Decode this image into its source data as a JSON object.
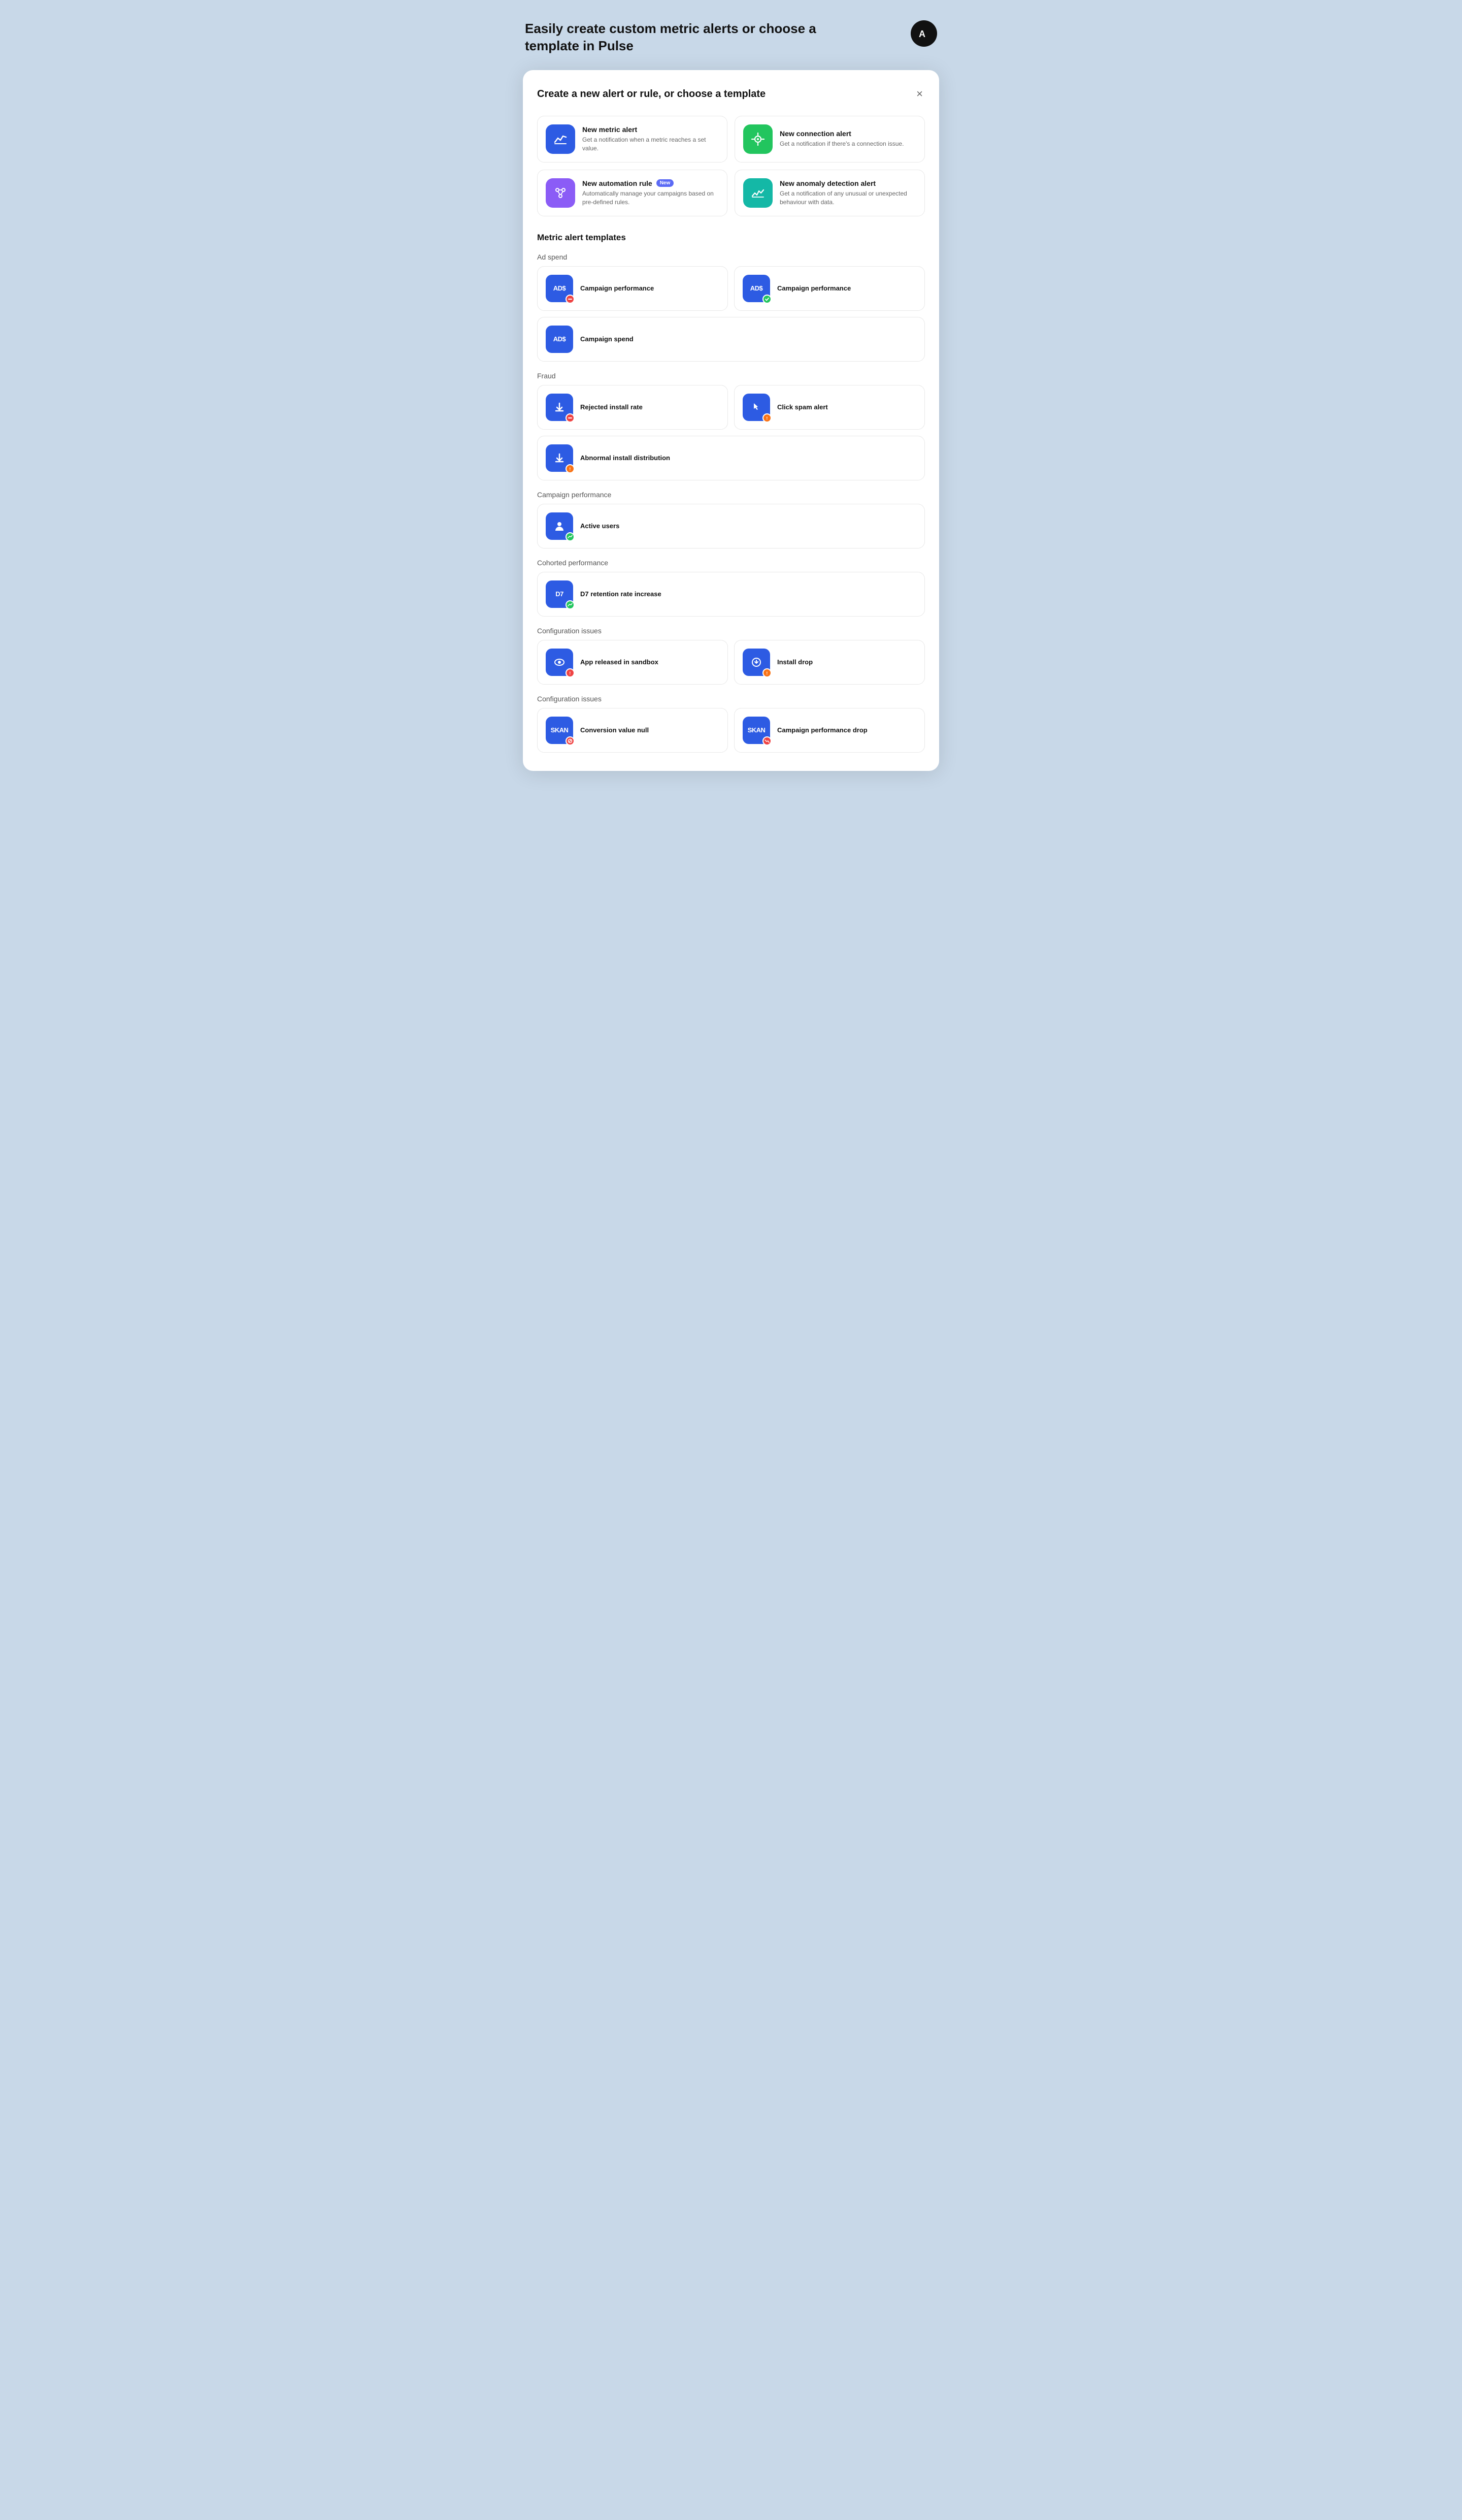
{
  "page": {
    "title": "Easily create custom metric alerts or choose a template in Pulse",
    "logo_alt": "Appsflyer logo"
  },
  "modal": {
    "title": "Create a new alert or rule, or choose a template",
    "close_label": "×"
  },
  "top_options": [
    {
      "id": "metric-alert",
      "title": "New metric alert",
      "desc": "Get a notification when a metric reaches a set value.",
      "icon_color": "#2d5be3",
      "icon_type": "chart"
    },
    {
      "id": "connection-alert",
      "title": "New connection alert",
      "desc": "Get a notification if there's a connection issue.",
      "icon_color": "#22c55e",
      "icon_type": "key"
    },
    {
      "id": "automation-rule",
      "title": "New automation rule",
      "desc": "Automatically manage your campaigns based on pre-defined rules.",
      "icon_color": "#8b5cf6",
      "icon_type": "nodes",
      "badge": "New"
    },
    {
      "id": "anomaly-alert",
      "title": "New anomaly detection alert",
      "desc": "Get a notification of any unusual or unexpected behaviour with data.",
      "icon_color": "#14b8a6",
      "icon_type": "anomaly"
    }
  ],
  "section_label": "Metric alert templates",
  "categories": [
    {
      "name": "Ad spend",
      "templates": [
        {
          "id": "campaign-perf-1",
          "label": "Campaign performance",
          "icon_text": "AD$",
          "icon_color": "#2d5be3",
          "badge_color": "#ef4444",
          "badge_icon": "minus"
        },
        {
          "id": "campaign-perf-2",
          "label": "Campaign performance",
          "icon_text": "AD$",
          "icon_color": "#2d5be3",
          "badge_color": "#22c55e",
          "badge_icon": "check"
        }
      ],
      "single": [
        {
          "id": "campaign-spend",
          "label": "Campaign spend",
          "icon_text": "AD$",
          "icon_color": "#2d5be3",
          "badge_color": null
        }
      ]
    },
    {
      "name": "Fraud",
      "templates": [
        {
          "id": "rejected-install",
          "label": "Rejected install rate",
          "icon_text": "↓",
          "icon_color": "#2d5be3",
          "badge_color": "#ef4444",
          "badge_icon": "minus"
        },
        {
          "id": "click-spam",
          "label": "Click spam alert",
          "icon_text": "👆",
          "icon_color": "#2d5be3",
          "badge_color": "#f97316",
          "badge_icon": "excl"
        }
      ],
      "single": [
        {
          "id": "abnormal-install",
          "label": "Abnormal install distribution",
          "icon_text": "↓",
          "icon_color": "#2d5be3",
          "badge_color": "#f97316",
          "badge_icon": "excl"
        }
      ]
    },
    {
      "name": "Campaign performance",
      "templates": [],
      "single": [
        {
          "id": "active-users",
          "label": "Active users",
          "icon_text": "user",
          "icon_color": "#2d5be3",
          "badge_color": "#22c55e",
          "badge_icon": "chart"
        }
      ]
    },
    {
      "name": "Cohorted performance",
      "templates": [],
      "single": [
        {
          "id": "d7-retention",
          "label": "D7 retention rate increase",
          "icon_text": "D7",
          "icon_color": "#2d5be3",
          "badge_color": "#22c55e",
          "badge_icon": "chart"
        }
      ]
    },
    {
      "name": "Configuration issues",
      "templates": [
        {
          "id": "app-sandbox",
          "label": "App released in sandbox",
          "icon_text": "eye",
          "icon_color": "#2d5be3",
          "badge_color": "#ef4444",
          "badge_icon": "excl"
        },
        {
          "id": "install-drop",
          "label": "Install drop",
          "icon_text": "gear",
          "icon_color": "#2d5be3",
          "badge_color": "#f97316",
          "badge_icon": "excl"
        }
      ],
      "single": []
    },
    {
      "name": "Configuration issues",
      "templates": [
        {
          "id": "conversion-null",
          "label": "Conversion value null",
          "icon_text": "SKAN",
          "icon_color": "#2d5be3",
          "badge_color": "#ef4444",
          "badge_icon": "block"
        },
        {
          "id": "campaign-perf-drop",
          "label": "Campaign performance drop",
          "icon_text": "SKAN",
          "icon_color": "#2d5be3",
          "badge_color": "#ef4444",
          "badge_icon": "chart-down"
        }
      ],
      "single": []
    }
  ]
}
